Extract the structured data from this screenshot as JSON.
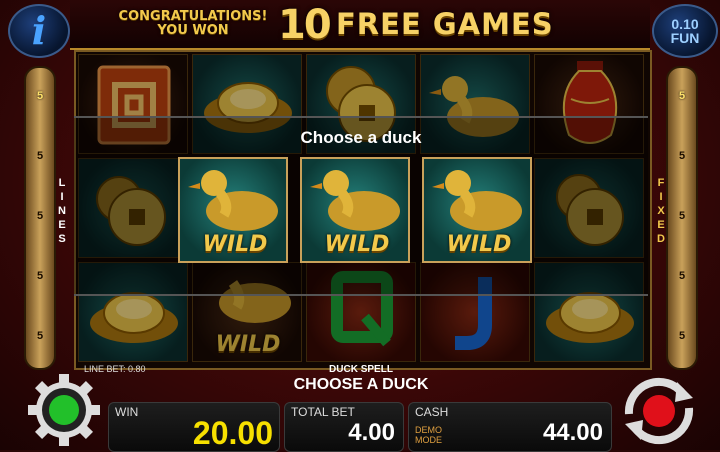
{
  "header": {
    "congrats_line1": "CONGRATULATIONS!",
    "congrats_line2": "YOU WON",
    "count": "10",
    "free_games": "FREE GAMES",
    "info_icon": "i",
    "bet_value": "0.10",
    "bet_unit": "FUN"
  },
  "left_panel": {
    "label": "LINES",
    "numbers": [
      "5",
      "5",
      "5",
      "5",
      "5"
    ]
  },
  "right_panel": {
    "label": "FIXED",
    "numbers": [
      "5",
      "5",
      "5",
      "5",
      "5"
    ]
  },
  "reels": {
    "symbols": [
      [
        "red-chinese-character",
        "gold-ingot",
        "gold-coins",
        "golden-duck",
        "red-vase"
      ],
      [
        "gold-coins",
        "golden-duck-wild",
        "golden-duck-wild",
        "golden-duck-wild",
        "gold-coins"
      ],
      [
        "gold-ingot",
        "golden-duck-wild",
        "letter-q",
        "letter-j",
        "gold-ingot"
      ]
    ],
    "wild_label": "WILD",
    "q_label": "Q",
    "j_label": "J",
    "chinese_char": "回"
  },
  "prompt": {
    "title": "Choose a duck",
    "duck_options": [
      "duck-1",
      "duck-2",
      "duck-3"
    ]
  },
  "status": {
    "line_bet": "LINE BET: 0.80",
    "spell": "DUCK SPELL",
    "choose": "CHOOSE A DUCK"
  },
  "bottom": {
    "win_label": "WIN",
    "win_value": "20.00",
    "total_bet_label": "TOTAL BET",
    "total_bet_value": "4.00",
    "cash_label": "CASH",
    "demo_line1": "DEMO",
    "demo_line2": "MODE",
    "cash_value": "44.00"
  },
  "colors": {
    "gold": "#f2c94c",
    "win_yellow": "#f7e000",
    "settings_green": "#22c02a",
    "spin_red": "#e0101a"
  },
  "icons": {
    "info": "info-icon",
    "settings": "gear-icon",
    "spin": "spin-arrows-icon"
  }
}
